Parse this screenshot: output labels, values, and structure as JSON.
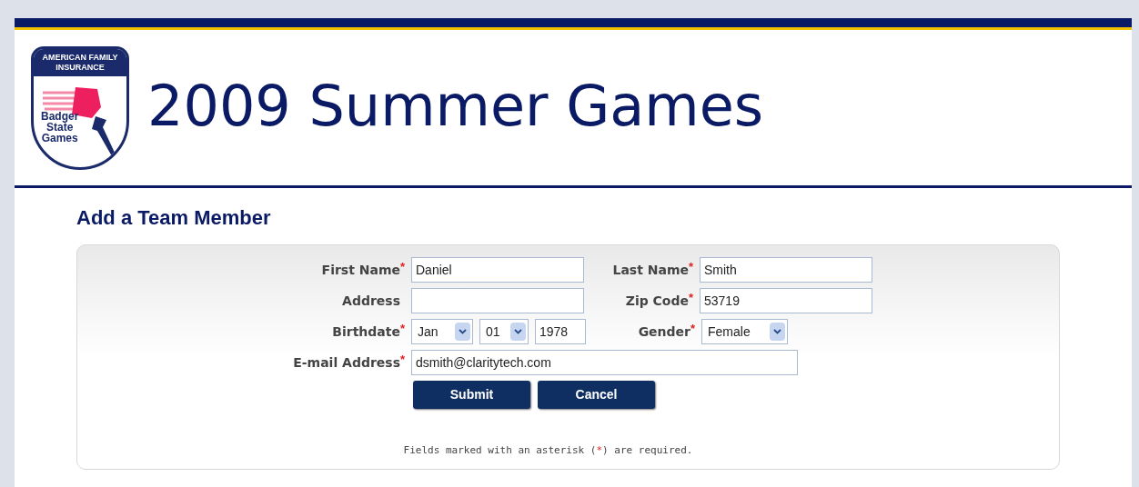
{
  "header": {
    "logo": {
      "sponsor_lines": [
        "AMERICAN FAMILY",
        "INSURANCE"
      ],
      "name_lines": [
        "Badger",
        "State",
        "Games"
      ]
    },
    "title": "2009 Summer Games"
  },
  "form": {
    "title": "Add a Team Member",
    "required_mark": "*",
    "rows": [
      {
        "fields": [
          {
            "label": "First Name",
            "required": true,
            "kind": "text",
            "value": "Daniel"
          },
          {
            "label": "Last Name",
            "required": true,
            "kind": "text",
            "value": "Smith"
          }
        ]
      },
      {
        "fields": [
          {
            "label": "Address",
            "required": false,
            "kind": "text"
          },
          {
            "label": "Zip Code",
            "required": true,
            "kind": "text",
            "value": "53719"
          }
        ]
      },
      {
        "fields": [
          {
            "label": "Birthdate",
            "required": true,
            "kind": "date",
            "parts": [
              {
                "kind": "select",
                "value": "Jan"
              },
              {
                "kind": "select",
                "value": "01"
              },
              {
                "kind": "text",
                "value": "1978"
              }
            ]
          },
          {
            "label": "Gender",
            "required": true,
            "kind": "select",
            "value": "Female"
          }
        ]
      },
      {
        "fields": [
          {
            "label": "E-mail Address",
            "required": true,
            "kind": "email",
            "value": "dsmith@claritytech.com"
          }
        ]
      }
    ],
    "buttons": [
      "Submit",
      "Cancel"
    ],
    "note": {
      "before": "Fields marked with an asterisk (",
      "mark": "*",
      "after": ") are required."
    }
  }
}
